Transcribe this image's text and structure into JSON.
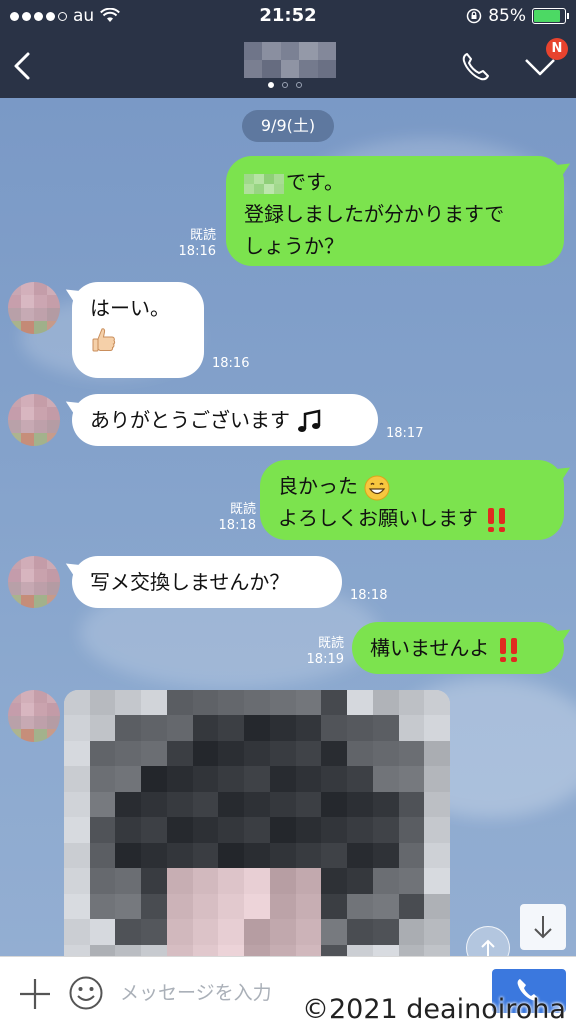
{
  "status_bar": {
    "carrier": "au",
    "time": "21:52",
    "battery": "85%"
  },
  "nav": {
    "notification_badge": "N"
  },
  "chat": {
    "date": "9/9(土)",
    "messages": [
      {
        "from": "me",
        "lines": [
          "です。",
          "登録しましたが分かりますで",
          "しょうか？"
        ],
        "read": "既読",
        "time": "18:16"
      },
      {
        "from": "other",
        "text": "はーい。",
        "time": "18:16"
      },
      {
        "from": "other",
        "text": "ありがとうございます",
        "time": "18:17"
      },
      {
        "from": "me",
        "lines": [
          "良かった",
          "よろしくお願いします"
        ],
        "read": "既読",
        "time": "18:18"
      },
      {
        "from": "other",
        "text": "写メ交換しませんか？",
        "time": "18:18"
      },
      {
        "from": "me",
        "text": "構いませんよ",
        "read": "既読",
        "time": "18:19"
      }
    ]
  },
  "input": {
    "placeholder": "メッセージを入力"
  },
  "watermark": "©2021 deainoiroha",
  "colors": {
    "header_bg": "#2a3346",
    "my_bubble": "#7ce34e",
    "other_bubble": "#ffffff",
    "chat_bg": "#7d9bc4",
    "call_button": "#3b78de"
  }
}
